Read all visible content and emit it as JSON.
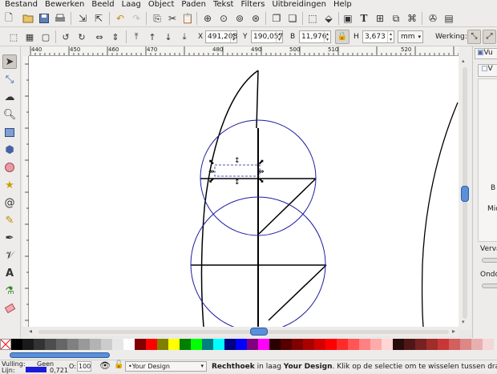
{
  "menu": [
    {
      "label": "Bestand"
    },
    {
      "label": "Bewerken"
    },
    {
      "label": "Beeld"
    },
    {
      "label": "Laag"
    },
    {
      "label": "Object"
    },
    {
      "label": "Paden"
    },
    {
      "label": "Tekst"
    },
    {
      "label": "Filters"
    },
    {
      "label": "Uitbreidingen"
    },
    {
      "label": "Help"
    }
  ],
  "controls": {
    "x_label": "X",
    "x_value": "491,208",
    "y_label": "Y",
    "y_value": "190,057",
    "w_label": "B",
    "w_value": "11,976",
    "h_label": "H",
    "h_value": "3,673",
    "unit": "mm",
    "affect_label": "Werking:"
  },
  "ruler": {
    "ticks": [
      "440",
      "450",
      "460",
      "470",
      "480",
      "490",
      "500",
      "510",
      "520"
    ]
  },
  "dock": {
    "tab_label": "Vu",
    "subtab_label": "V",
    "b_label": "B",
    "mid_label": "Mid",
    "verv_label": "Verva",
    "ondo_label": "Ondo"
  },
  "palette": {
    "colors": [
      "#000000",
      "#1a1a1a",
      "#333333",
      "#4d4d4d",
      "#666666",
      "#808080",
      "#999999",
      "#b3b3b3",
      "#cccccc",
      "#e6e6e6",
      "#ffffff",
      "#800000",
      "#ff0000",
      "#808000",
      "#ffff00",
      "#008000",
      "#00ff00",
      "#008080",
      "#00ffff",
      "#000080",
      "#0000ff",
      "#800080",
      "#ff00ff",
      "#2b0000",
      "#550000",
      "#800000",
      "#aa0000",
      "#d40000",
      "#ff0000",
      "#ff2a2a",
      "#ff5555",
      "#ff8080",
      "#ffaaaa",
      "#ffd5d5",
      "#280b0b",
      "#501616",
      "#782121",
      "#a02c2c",
      "#c83737",
      "#d35f5f",
      "#de8787",
      "#e9afaf",
      "#f4d7d7"
    ]
  },
  "status": {
    "fill_label": "Vulling:",
    "fill_value": "Geen",
    "stroke_label": "Lijn:",
    "stroke_width": "0,721",
    "stroke_color": "#1a1adc",
    "opacity_label": "O:",
    "opacity_value": "100",
    "layer": "•Your Design",
    "message_pre": "Rechthoek",
    "message_mid": " in laag ",
    "message_layer": "Your Design",
    "message_post": ". Klik op de selectie om te wisselen tussen draaien"
  }
}
